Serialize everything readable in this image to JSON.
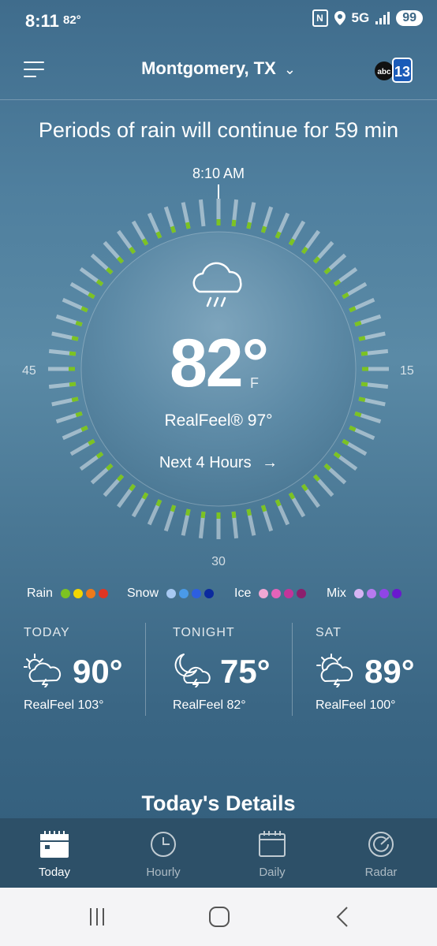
{
  "status_bar": {
    "time": "8:11",
    "temp": "82°",
    "network": "5G",
    "battery": "99"
  },
  "header": {
    "location": "Montgomery, TX",
    "logo_text_small": "abc",
    "logo_text_big": "13"
  },
  "headline": "Periods of rain will continue for 59 min",
  "dial": {
    "time_label": "8:10 AM",
    "mark_45": "45",
    "mark_15": "15",
    "mark_30": "30",
    "temperature": "82°",
    "unit": "F",
    "realfeel": "RealFeel® 97°",
    "next_hours": "Next 4 Hours",
    "rain_minutes": [
      0,
      1,
      2,
      3,
      4,
      5,
      6,
      7,
      8,
      9,
      10,
      11,
      12,
      13,
      14,
      15,
      16,
      17,
      18,
      19,
      20,
      21,
      22,
      23,
      24,
      25,
      26,
      27,
      28,
      29,
      30,
      31,
      32,
      33,
      34,
      35,
      36,
      37,
      38,
      39,
      40,
      41,
      42,
      43,
      44,
      45,
      46,
      47,
      48,
      49,
      50,
      51,
      52,
      53,
      54,
      55,
      56,
      57,
      58
    ],
    "icon": "cloud-rain-icon"
  },
  "legend": {
    "rain": {
      "label": "Rain",
      "colors": [
        "#7cc322",
        "#f2d500",
        "#ee7a1a",
        "#e03523"
      ]
    },
    "snow": {
      "label": "Snow",
      "colors": [
        "#a7c9f2",
        "#4a9ae8",
        "#2d5fe0",
        "#0b2a9e"
      ]
    },
    "ice": {
      "label": "Ice",
      "colors": [
        "#f1a7d4",
        "#e463b9",
        "#c4349a",
        "#8c1f6d"
      ]
    },
    "mix": {
      "label": "Mix",
      "colors": [
        "#d6b4f4",
        "#b77aef",
        "#9045e6",
        "#6a18cf"
      ]
    }
  },
  "forecast": [
    {
      "title": "TODAY",
      "temp": "90°",
      "realfeel": "RealFeel 103°",
      "icon": "sun-cloud-storm-icon"
    },
    {
      "title": "TONIGHT",
      "temp": "75°",
      "realfeel": "RealFeel 82°",
      "icon": "moon-cloud-storm-icon"
    },
    {
      "title": "SAT",
      "temp": "89°",
      "realfeel": "RealFeel 100°",
      "icon": "sun-cloud-storm-icon"
    }
  ],
  "details_title": "Today's Details",
  "tabs": [
    {
      "label": "Today",
      "icon": "calendar-today-icon",
      "active": true
    },
    {
      "label": "Hourly",
      "icon": "clock-icon",
      "active": false
    },
    {
      "label": "Daily",
      "icon": "calendar-icon",
      "active": false
    },
    {
      "label": "Radar",
      "icon": "radar-icon",
      "active": false
    }
  ]
}
